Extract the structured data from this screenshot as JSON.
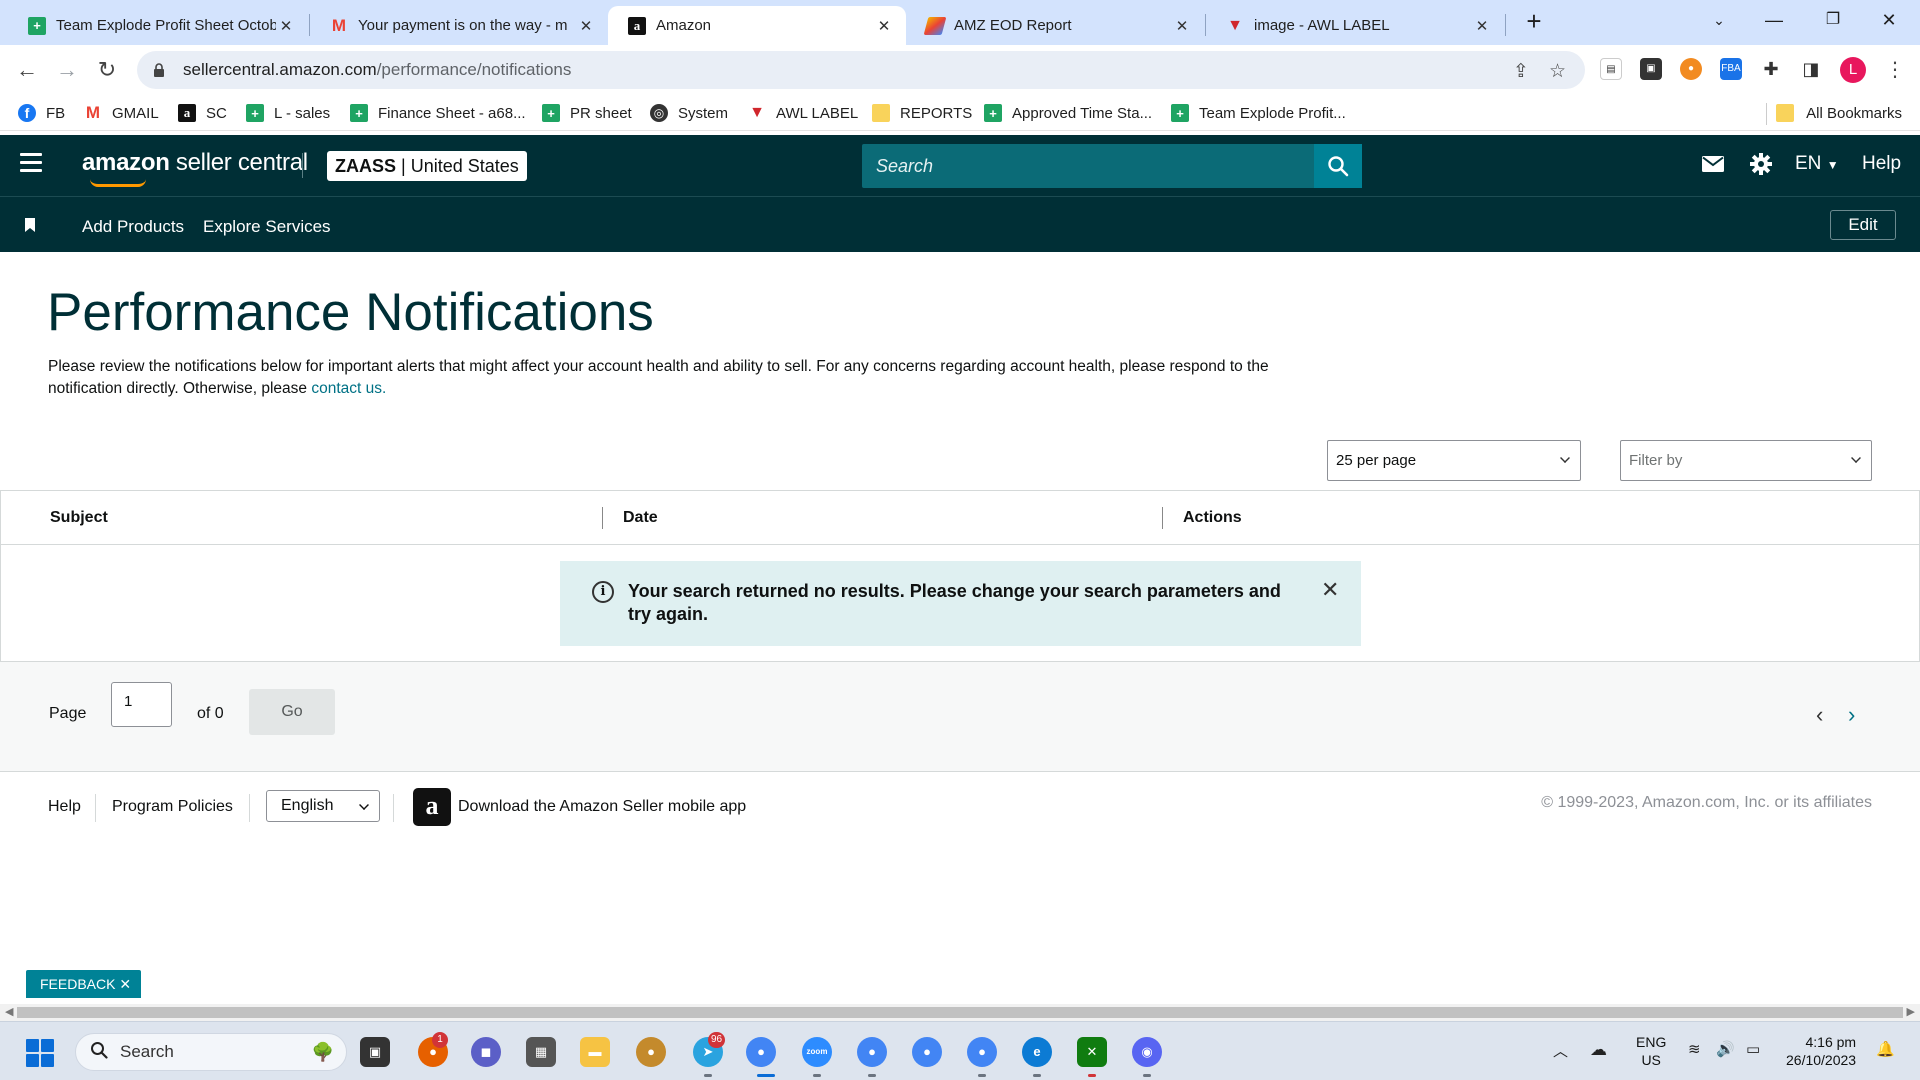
{
  "browser": {
    "tabs": [
      {
        "title": "Team Explode Profit Sheet Octob",
        "favicon": "sheets-icon"
      },
      {
        "title": "Your payment is on the way - m",
        "favicon": "gmail-icon"
      },
      {
        "title": "Amazon",
        "favicon": "amazon-icon",
        "active": true
      },
      {
        "title": "AMZ EOD Report",
        "favicon": "eod-report-icon"
      },
      {
        "title": "image - AWL LABEL",
        "favicon": "awl-label-icon"
      }
    ],
    "url_host": "sellercentral.amazon.com",
    "url_path": "/performance/notifications",
    "profile_initial": "L",
    "bookmarks": [
      {
        "label": "FB",
        "icon": "facebook-icon"
      },
      {
        "label": "GMAIL",
        "icon": "gmail-icon"
      },
      {
        "label": "SC",
        "icon": "amazon-icon"
      },
      {
        "label": "L - sales",
        "icon": "sheets-icon"
      },
      {
        "label": "Finance Sheet - a68...",
        "icon": "sheets-icon"
      },
      {
        "label": "PR sheet",
        "icon": "sheets-icon"
      },
      {
        "label": "System",
        "icon": "globe-icon"
      },
      {
        "label": "AWL LABEL",
        "icon": "awl-label-icon"
      },
      {
        "label": "REPORTS",
        "icon": "folder-icon"
      },
      {
        "label": "Approved Time Sta...",
        "icon": "sheets-icon"
      },
      {
        "label": "Team Explode Profit...",
        "icon": "sheets-icon"
      }
    ],
    "all_bookmarks": "All Bookmarks"
  },
  "header": {
    "logo_bold": "amazon",
    "logo_rest": " seller central",
    "account_bold": "ZAASS",
    "account_region": " | United States",
    "search_placeholder": "Search",
    "language": "EN",
    "help": "Help"
  },
  "subnav": {
    "links": [
      "Add Products",
      "Explore Services"
    ],
    "edit": "Edit"
  },
  "main": {
    "title": "Performance Notifications",
    "description": "Please review the notifications below for important alerts that might affect your account health and ability to sell. For any concerns regarding account health, please respond to the notification directly. Otherwise, please ",
    "contact_link": "contact us.",
    "per_page": "25 per page",
    "filter_placeholder": "Filter by",
    "columns": [
      "Subject",
      "Date",
      "Actions"
    ],
    "no_results": "Your search returned no results. Please change your search parameters and try again."
  },
  "pagination": {
    "page_label": "Page",
    "page_value": "1",
    "of_label": "of 0",
    "go": "Go"
  },
  "footer": {
    "help": "Help",
    "program_policies": "Program Policies",
    "language": "English",
    "app_link": "Download the Amazon Seller mobile app",
    "copyright": "© 1999-2023, Amazon.com, Inc. or its affiliates"
  },
  "feedback": "FEEDBACK",
  "taskbar": {
    "search": "Search",
    "lang_top": "ENG",
    "lang_bottom": "US",
    "time": "4:16 pm",
    "date": "26/10/2023",
    "badges": {
      "firefox": "1",
      "telegram": "96"
    }
  },
  "colors": {
    "header_bg": "#002f36",
    "search_bg": "#0b6b77",
    "search_button": "#008296",
    "link": "#007185",
    "notice_bg": "#dff0f1",
    "tab_strip": "#d3e3fd"
  }
}
